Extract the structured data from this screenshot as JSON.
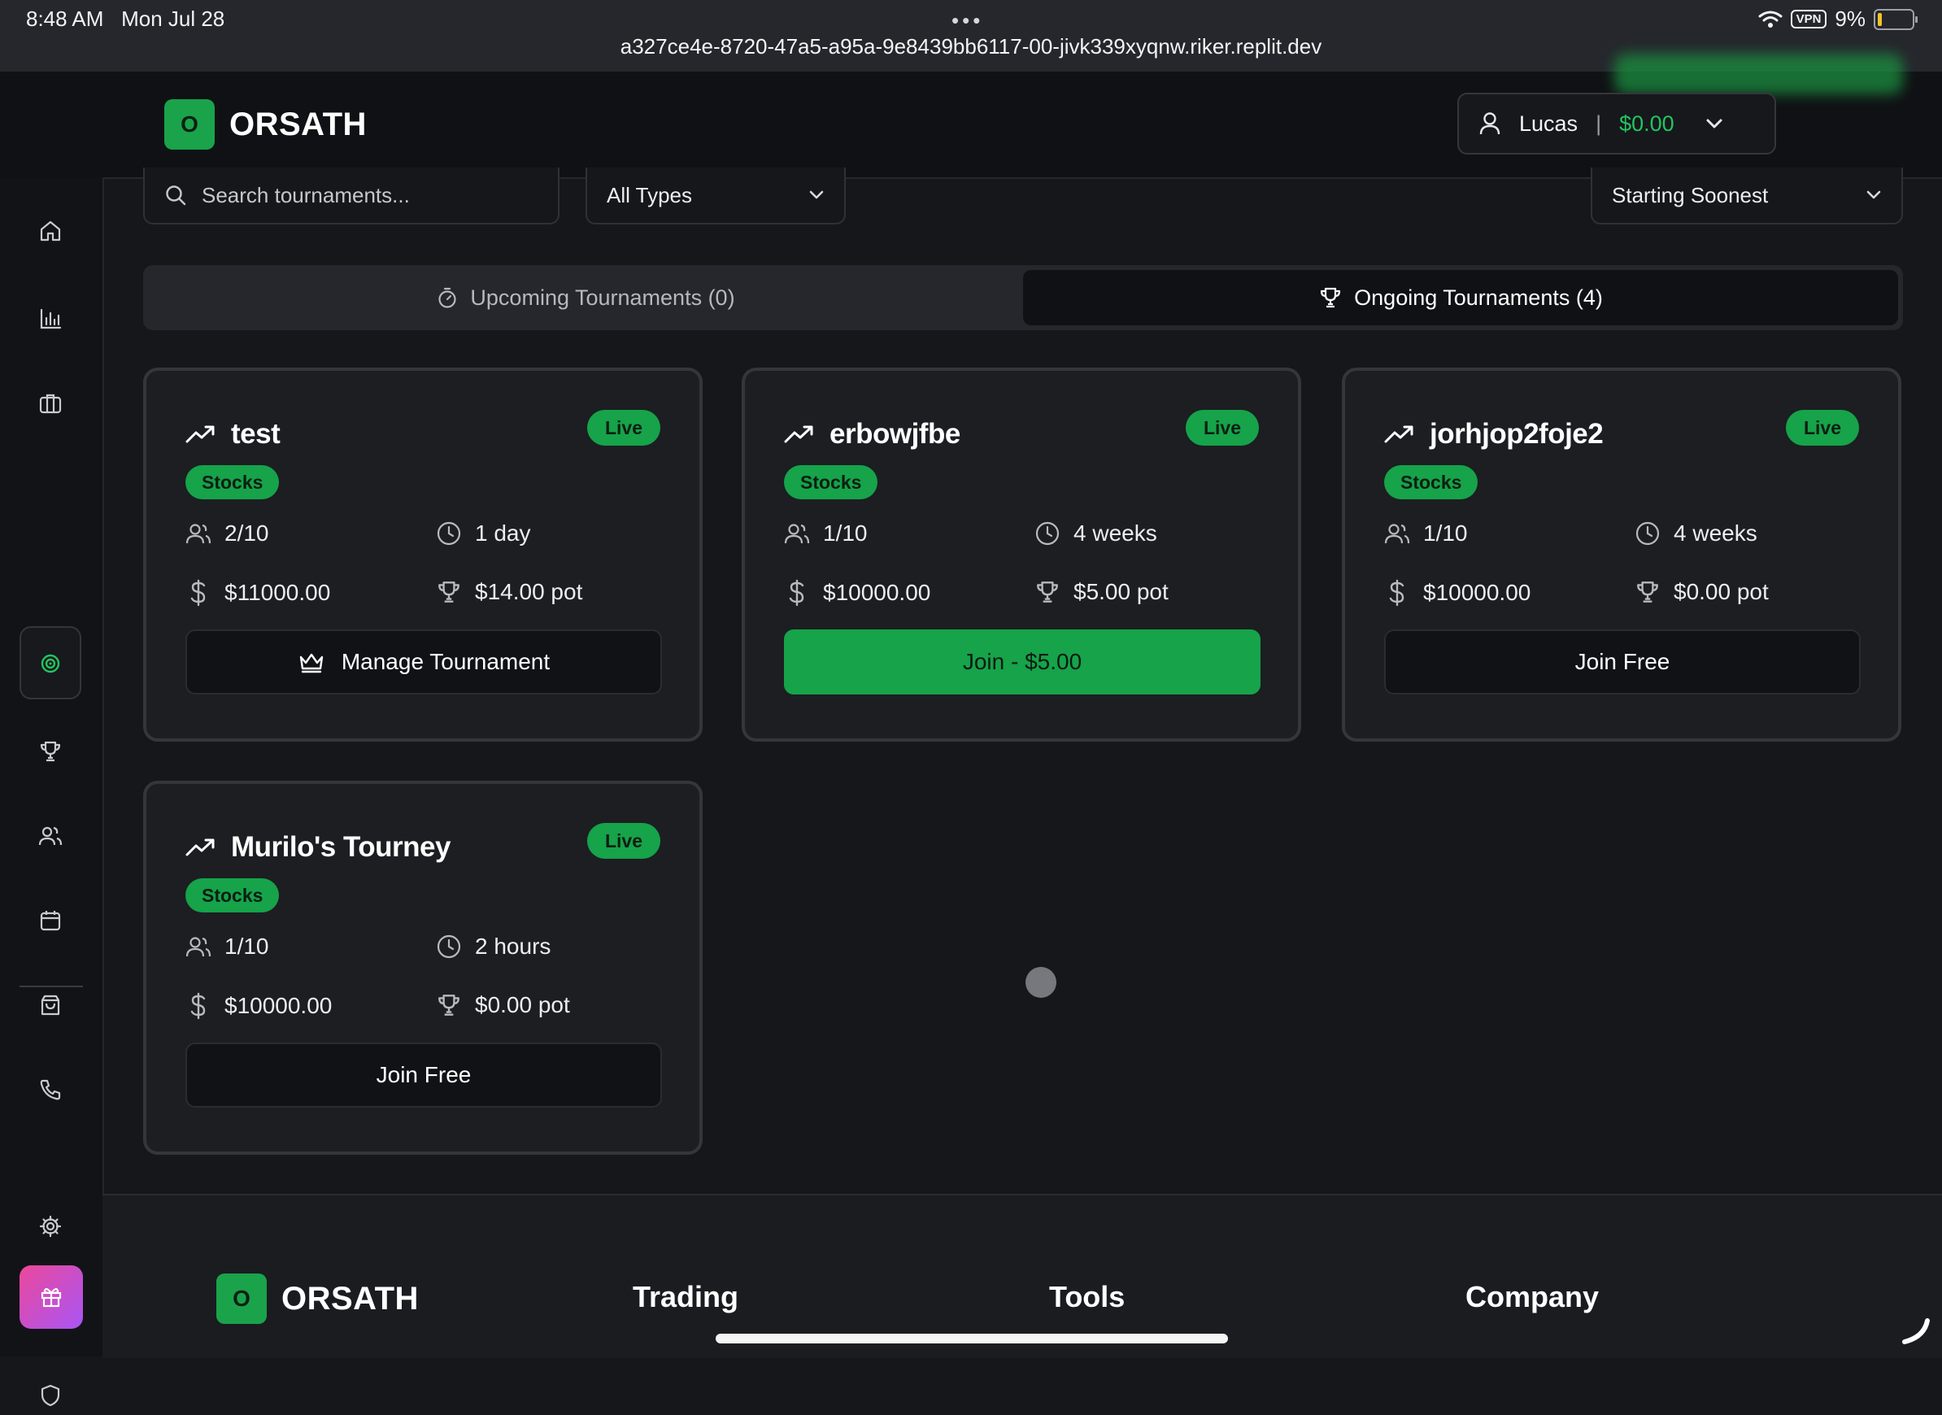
{
  "status_bar": {
    "time": "8:48 AM",
    "date": "Mon Jul 28",
    "dots": "•••",
    "url": "a327ce4e-8720-47a5-a95a-9e8439bb6117-00-jivk339xyqnw.riker.replit.dev",
    "vpn": "VPN",
    "battery": "9%"
  },
  "brand": {
    "logo_letter": "O",
    "name": "ORSATH"
  },
  "user": {
    "name": "Lucas",
    "separator": "|",
    "balance": "$0.00"
  },
  "filters": {
    "search_placeholder": "Search tournaments...",
    "type_value": "All Types",
    "sort_value": "Starting Soonest"
  },
  "tabs": [
    {
      "label": "Upcoming Tournaments (0)",
      "icon": "timer-icon",
      "active": false
    },
    {
      "label": "Ongoing Tournaments (4)",
      "icon": "trophy-icon",
      "active": true
    }
  ],
  "tournaments": [
    {
      "name": "test",
      "status": "Live",
      "type": "Stocks",
      "players": "2/10",
      "duration": "1 day",
      "balance": "$11000.00",
      "pot": "$14.00 pot",
      "action": "Manage Tournament",
      "action_style": "dark-crown"
    },
    {
      "name": "erbowjfbe",
      "status": "Live",
      "type": "Stocks",
      "players": "1/10",
      "duration": "4 weeks",
      "balance": "$10000.00",
      "pot": "$5.00 pot",
      "action": "Join - $5.00",
      "action_style": "green"
    },
    {
      "name": "jorhjop2foje2",
      "status": "Live",
      "type": "Stocks",
      "players": "1/10",
      "duration": "4 weeks",
      "balance": "$10000.00",
      "pot": "$0.00 pot",
      "action": "Join Free",
      "action_style": "dark"
    },
    {
      "name": "Murilo's Tourney",
      "status": "Live",
      "type": "Stocks",
      "players": "1/10",
      "duration": "2 hours",
      "balance": "$10000.00",
      "pot": "$0.00 pot",
      "action": "Join Free",
      "action_style": "dark"
    }
  ],
  "sidebar_icons": [
    "home-icon",
    "bar-chart-icon",
    "briefcase-icon",
    "target-icon",
    "trophy-icon",
    "users-icon",
    "calendar-icon",
    "shopping-bag-icon",
    "phone-icon",
    "settings-icon",
    "archive-icon",
    "shield-icon",
    "gift-icon"
  ],
  "footer": {
    "brand": "ORSATH",
    "columns": [
      "Trading",
      "Tools",
      "Company"
    ]
  },
  "colors": {
    "accent": "#16a34a",
    "balance": "#22c55e",
    "background": "#15171b",
    "card": "#1c1e22"
  }
}
